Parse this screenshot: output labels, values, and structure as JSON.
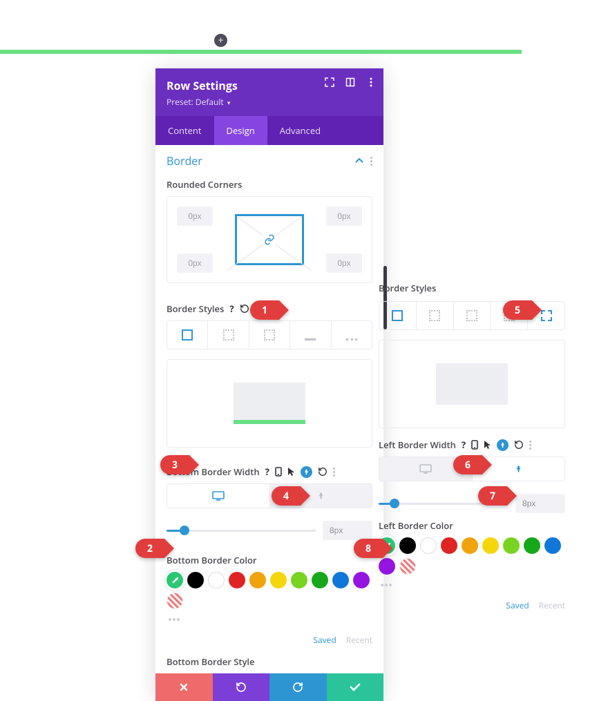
{
  "add_button_label": "+",
  "panel": {
    "title": "Row Settings",
    "preset_prefix": "Preset:",
    "preset_value": "Default"
  },
  "tabs": {
    "content": "Content",
    "design": "Design",
    "advanced": "Advanced"
  },
  "section": {
    "title": "Border"
  },
  "rounded_corners": {
    "label": "Rounded Corners",
    "tl": "0px",
    "tr": "0px",
    "bl": "0px",
    "br": "0px"
  },
  "border_styles": {
    "label": "Border Styles"
  },
  "bottom_border_width": {
    "label": "Bottom Border Width",
    "value": "8px"
  },
  "bottom_border_color": {
    "label": "Bottom Border Color"
  },
  "bottom_border_style": {
    "label": "Bottom Border Style"
  },
  "left_border_width": {
    "label": "Left Border Width",
    "value": "8px"
  },
  "left_border_color": {
    "label": "Left Border Color"
  },
  "saved_label": "Saved",
  "recent_label": "Recent",
  "swatch_colors": [
    "#000000",
    "#ffffff",
    "#e02424",
    "#f0a30a",
    "#f5d60a",
    "#79d321",
    "#17a81a",
    "#1077d8",
    "#9514e0"
  ],
  "callouts": {
    "1": "1",
    "2": "2",
    "3": "3",
    "4": "4",
    "5": "5",
    "6": "6",
    "7": "7",
    "8": "8"
  }
}
